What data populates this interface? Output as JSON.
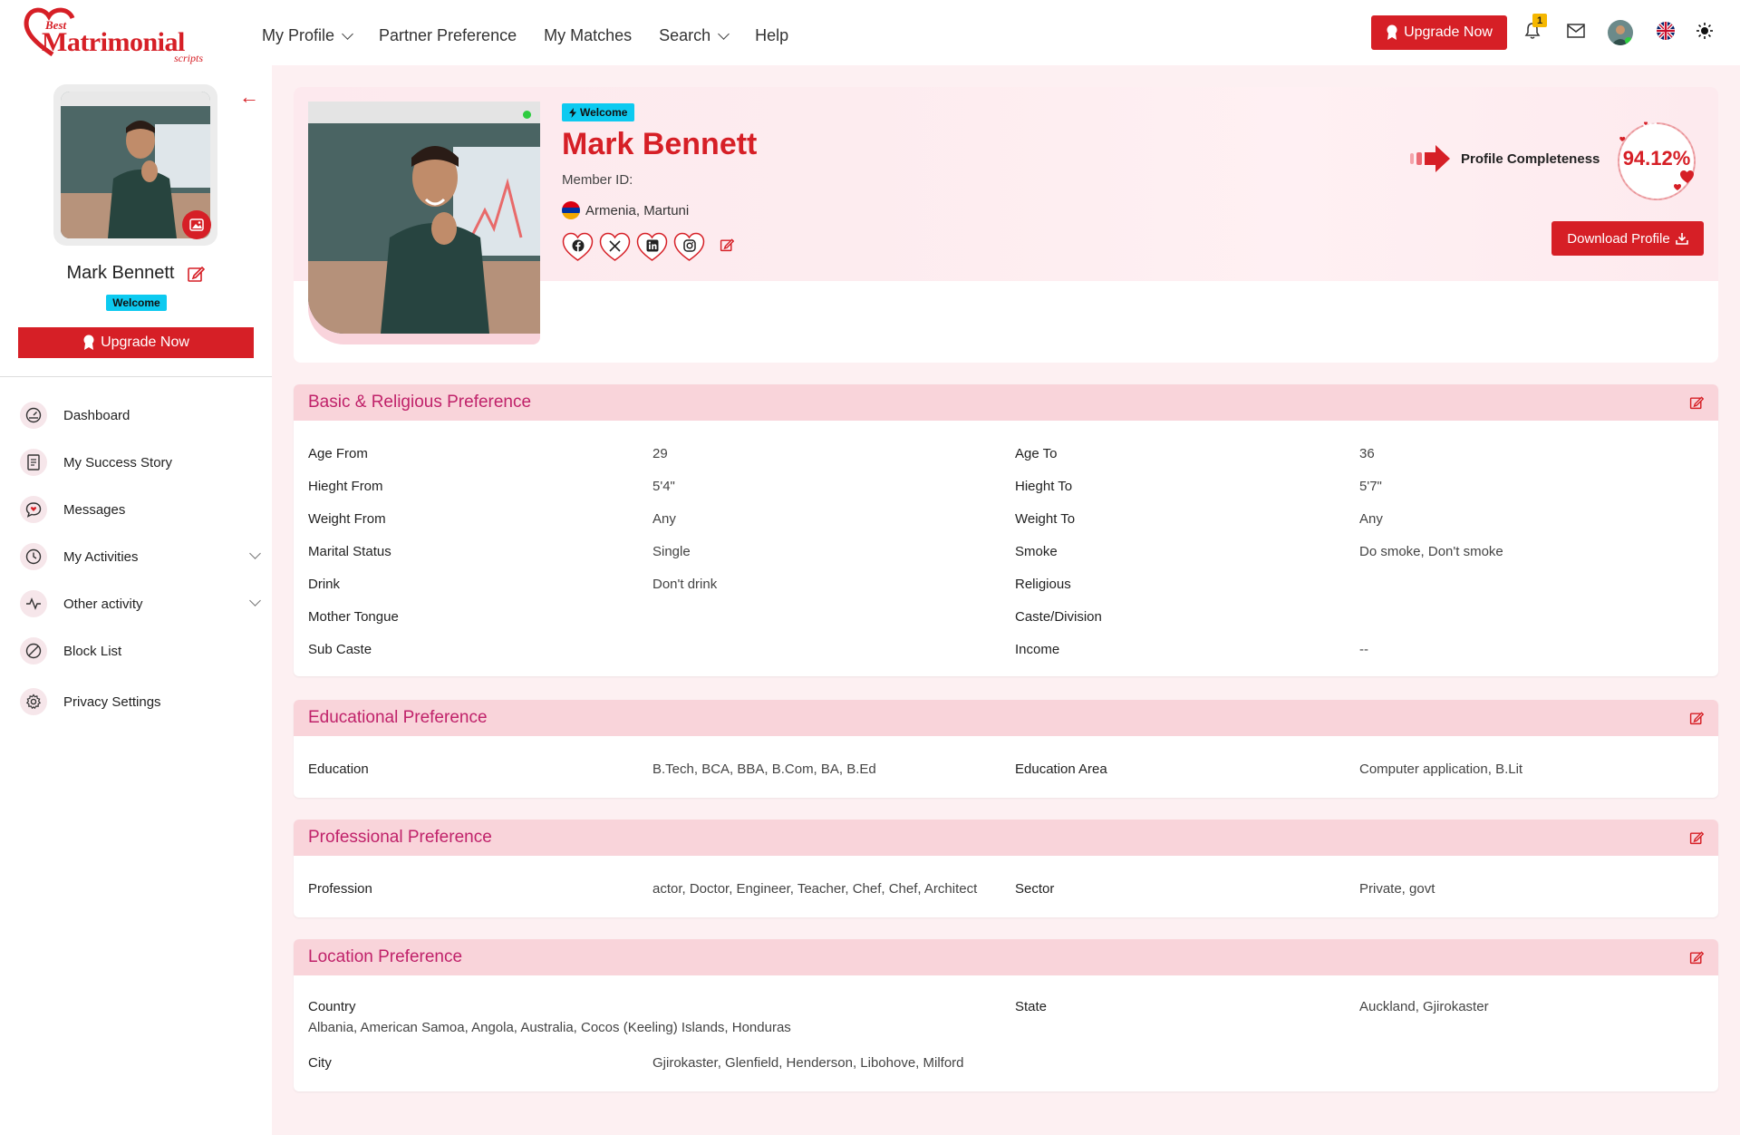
{
  "brand": {
    "small": "Best",
    "main": "Matrimonial",
    "sub": "scripts"
  },
  "nav": {
    "items": [
      {
        "label": "My Profile",
        "dropdown": true
      },
      {
        "label": "Partner Preference",
        "dropdown": false
      },
      {
        "label": "My Matches",
        "dropdown": false
      },
      {
        "label": "Search",
        "dropdown": true
      },
      {
        "label": "Help",
        "dropdown": false
      }
    ]
  },
  "header": {
    "upgrade_label": "Upgrade Now",
    "notification_count": "1",
    "icons": [
      "bell-icon",
      "mail-icon",
      "avatar",
      "uk-flag-icon",
      "sun-icon"
    ]
  },
  "sidebar": {
    "name": "Mark Bennett",
    "badge": "Welcome",
    "upgrade_label": "Upgrade Now",
    "menu": [
      {
        "label": "Dashboard",
        "icon": "dashboard-icon",
        "expandable": false
      },
      {
        "label": "My Success Story",
        "icon": "document-icon",
        "expandable": false
      },
      {
        "label": "Messages",
        "icon": "chat-heart-icon",
        "expandable": false
      },
      {
        "label": "My Activities",
        "icon": "clock-icon",
        "expandable": true
      },
      {
        "label": "Other activity",
        "icon": "activity-icon",
        "expandable": true
      },
      {
        "label": "Block List",
        "icon": "block-icon",
        "expandable": false
      },
      {
        "label": "Privacy Settings",
        "icon": "gear-icon",
        "expandable": false
      }
    ]
  },
  "profile": {
    "badge": "Welcome",
    "name": "Mark Bennett",
    "member_id_label": "Member ID:",
    "location": "Armenia, Martuni",
    "socials": [
      "facebook-icon",
      "x-icon",
      "linkedin-icon",
      "instagram-icon"
    ],
    "completeness_label": "Profile Completeness",
    "completeness_value": "94.12%",
    "completeness_fraction": 0.9412,
    "download_label": "Download Profile"
  },
  "sections": {
    "basic": {
      "title": "Basic & Religious Preference",
      "rows": [
        [
          "Age From",
          "29",
          "Age To",
          "36"
        ],
        [
          "Hieght From",
          "5'4\"",
          "Hieght To",
          "5'7\""
        ],
        [
          "Weight From",
          "Any",
          "Weight To",
          "Any"
        ],
        [
          "Marital Status",
          "Single",
          "Smoke",
          "Do smoke, Don't smoke"
        ],
        [
          "Drink",
          "Don't drink",
          "Religious",
          ""
        ],
        [
          "Mother Tongue",
          "",
          "Caste/Division",
          ""
        ],
        [
          "Sub Caste",
          "",
          "Income",
          "--"
        ]
      ]
    },
    "education": {
      "title": "Educational Preference",
      "rows": [
        [
          "Education",
          "B.Tech, BCA, BBA, B.Com, BA, B.Ed",
          "Education Area",
          "Computer application, B.Lit"
        ]
      ]
    },
    "professional": {
      "title": "Professional Preference",
      "rows": [
        [
          "Profession",
          "actor, Doctor, Engineer, Teacher, Chef, Chef, Architect",
          "Sector",
          "Private, govt"
        ]
      ]
    },
    "location": {
      "title": "Location Preference",
      "country_label": "Country",
      "country_value": "Albania, American Samoa, Angola, Australia, Cocos (Keeling) Islands, Honduras",
      "state_label": "State",
      "state_value": "Auckland, Gjirokaster",
      "city_label": "City",
      "city_value": "Gjirokaster, Glenfield, Henderson, Libohove, Milford"
    }
  },
  "colors": {
    "accent": "#d61f26",
    "section_head": "#f9d4da",
    "section_title": "#c0226a",
    "badge": "#0dcaf0",
    "main_bg": "#fdf0f2"
  }
}
